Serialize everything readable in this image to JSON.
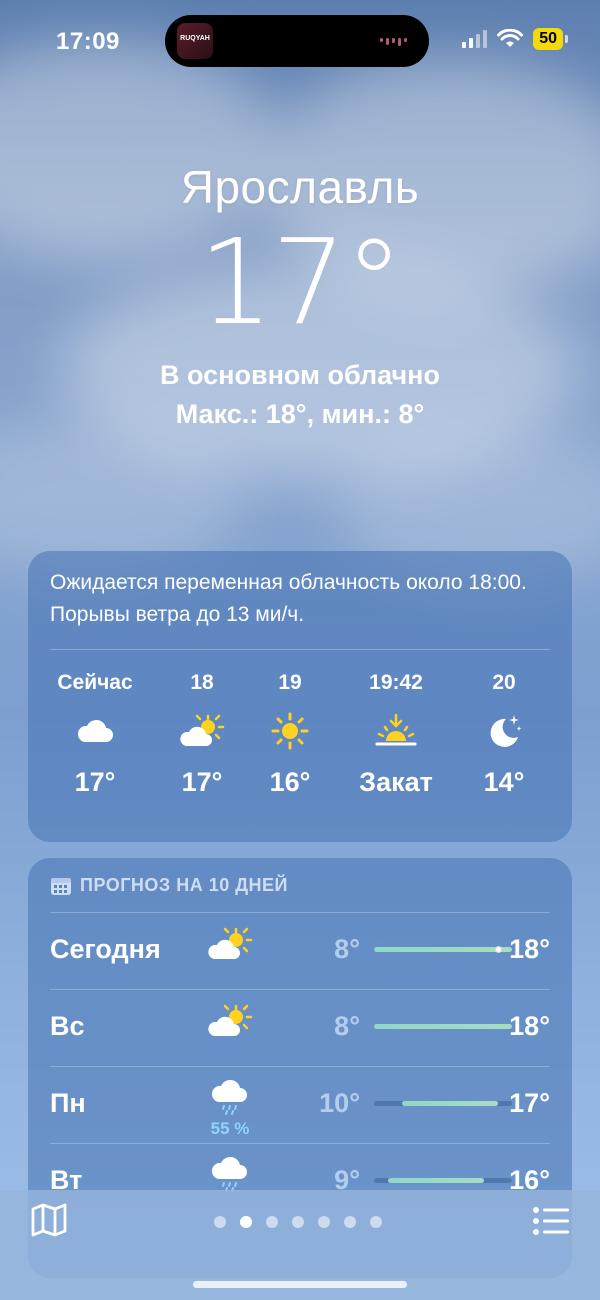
{
  "status_bar": {
    "time": "17:09",
    "island_app_text": "RUQYAH",
    "battery": "50",
    "icons": [
      "signal-icon",
      "wifi-icon",
      "battery-icon"
    ]
  },
  "location": {
    "city": "Ярославль",
    "temperature": "17°",
    "condition": "В основном облачно",
    "high_low": "Макс.: 18°, мин.: 8°"
  },
  "hourly": {
    "summary": "Ожидается переменная облачность около 18:00. Порывы ветра до 13 ми/ч.",
    "items": [
      {
        "label": "Сейчас",
        "icon": "cloud-icon",
        "value": "17°"
      },
      {
        "label": "18",
        "icon": "partly-sunny-icon",
        "value": "17°"
      },
      {
        "label": "19",
        "icon": "sun-icon",
        "value": "16°"
      },
      {
        "label": "19:42",
        "icon": "sunset-icon",
        "value": "Закат"
      },
      {
        "label": "20",
        "icon": "moon-stars-icon",
        "value": "14°"
      }
    ]
  },
  "forecast": {
    "header": "ПРОГНОЗ НА 10 ДНЕЙ",
    "range_min": 8,
    "range_max": 18,
    "days": [
      {
        "day": "Сегодня",
        "icon": "partly-sunny-icon",
        "pop": "",
        "low": "8°",
        "high": "18°",
        "low_val": 8,
        "high_val": 18,
        "current_val": 17
      },
      {
        "day": "Вс",
        "icon": "partly-sunny-icon",
        "pop": "",
        "low": "8°",
        "high": "18°",
        "low_val": 8,
        "high_val": 18
      },
      {
        "day": "Пн",
        "icon": "rain-cloud-icon",
        "pop": "55 %",
        "low": "10°",
        "high": "17°",
        "low_val": 10,
        "high_val": 17
      },
      {
        "day": "Вт",
        "icon": "rain-cloud-icon",
        "pop": "",
        "low": "9°",
        "high": "16°",
        "low_val": 9,
        "high_val": 16
      }
    ]
  },
  "bottom_bar": {
    "pages": 7,
    "active_page": 1
  }
}
